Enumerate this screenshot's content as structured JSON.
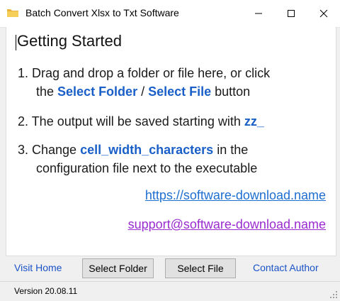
{
  "window": {
    "title": "Batch Convert Xlsx to Txt Software",
    "icon": "folder-icon",
    "controls": [
      "minimize-icon",
      "maximize-icon",
      "close-icon"
    ]
  },
  "content": {
    "heading": "Getting Started",
    "step1": {
      "prefix": "1. Drag and drop a folder or file here, or click",
      "line2_before": "the ",
      "select_folder": "Select Folder",
      "slash": " / ",
      "select_file": "Select File",
      "line2_after": " button"
    },
    "step2": {
      "text": "2. The output will be saved starting with ",
      "prefix_value": "zz_"
    },
    "step3": {
      "before": "3. Change ",
      "setting": "cell_width_characters",
      "after": " in the",
      "line2": "configuration file next to the executable"
    },
    "website_link": "https://software-download.name",
    "support_link": "support@software-download.name"
  },
  "bottom": {
    "visit_home": "Visit Home",
    "select_folder_button": "Select Folder",
    "select_file_button": "Select File",
    "contact_author": "Contact Author"
  },
  "status": {
    "version": "Version 20.08.11"
  },
  "colors": {
    "highlight": "#1a5fc7",
    "link": "#1e6fd0",
    "support_link": "#9a2bd0",
    "bottom_link": "#1a52c8"
  }
}
